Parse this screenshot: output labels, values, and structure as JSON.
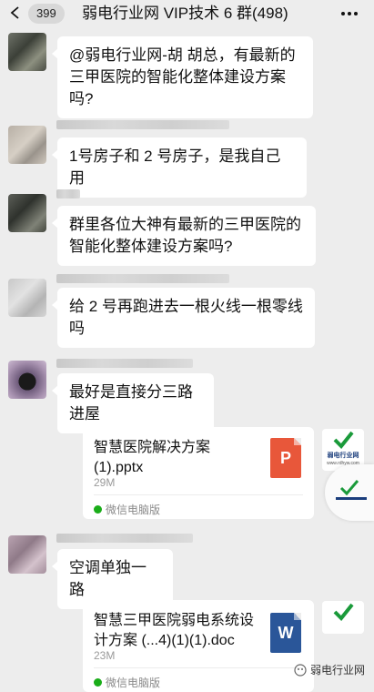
{
  "header": {
    "unread_count": "399",
    "title": "弱电行业网 VIP技术 6 群(498)"
  },
  "messages": [
    {
      "type": "text",
      "text": "@弱电行业网-胡 胡总，有最新的三甲医院的智能化整体建设方案吗?"
    },
    {
      "type": "text",
      "text": "1号房子和 2 号房子，是我自己用"
    },
    {
      "type": "text",
      "text": "群里各位大神有最新的三甲医院的智能化整体建设方案吗?"
    },
    {
      "type": "text",
      "text": "给 2 号再跑进去一根火线一根零线吗"
    },
    {
      "type": "text",
      "text": "最好是直接分三路进屋"
    },
    {
      "type": "file",
      "name": "智慧医院解决方案(1).pptx",
      "size": "29M",
      "source": "微信电脑版",
      "file_icon": "P"
    },
    {
      "type": "text",
      "text": "空调单独一路"
    },
    {
      "type": "file",
      "name": "智慧三甲医院弱电系统设计方案 (...4)(1)(1).doc",
      "size": "23M",
      "source": "微信电脑版",
      "file_icon": "W"
    }
  ],
  "watermark": {
    "brand": "弱电行业网",
    "url": "www.rdhyw.com",
    "footer": "弱电行业网"
  },
  "colors": {
    "background": "#ededed",
    "bubble": "#ffffff",
    "ppt_icon": "#e8573a",
    "doc_icon": "#2a5699",
    "source_dot": "#1aad19"
  }
}
